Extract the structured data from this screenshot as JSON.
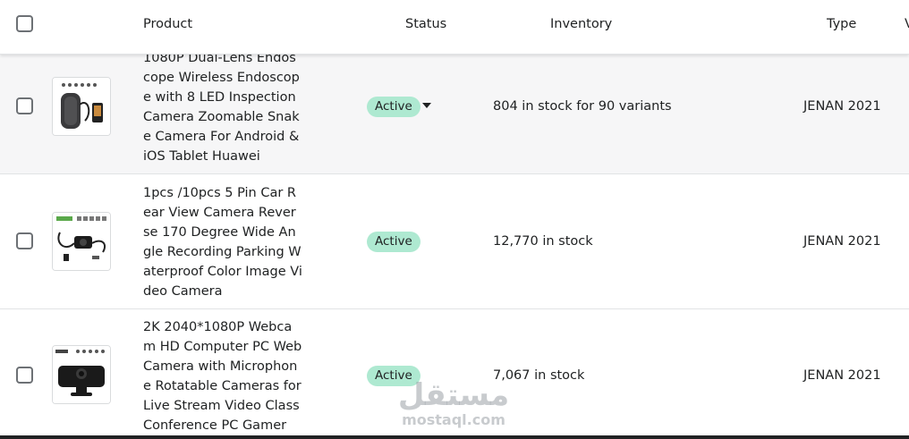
{
  "header": {
    "product_label": "Product",
    "status_label": "Status",
    "inventory_label": "Inventory",
    "type_label": "Type",
    "overflow_label": "V"
  },
  "rows": [
    {
      "name": "1080P Dual-Lens Endoscope Wireless Endoscope with 8 LED Inspection Camera Zoomable Snake Camera For Android & iOS Tablet Huawei",
      "status": "Active",
      "inventory": "804 in stock for 90 variants",
      "type": "JENAN 2021",
      "hovered": true
    },
    {
      "name": "1pcs /10pcs 5 Pin Car Rear View Camera Reverse 170 Degree Wide Angle Recording Parking Waterproof Color Image Video Camera",
      "status": "Active",
      "inventory": "12,770 in stock",
      "type": "JENAN 2021",
      "hovered": false
    },
    {
      "name": "2K 2040*1080P Webcam HD Computer PC WebCamera with Microphone Rotatable Cameras for Live Stream Video Class Conference PC Gamer",
      "status": "Active",
      "inventory": "7,067 in stock",
      "type": "JENAN 2021",
      "hovered": false
    }
  ],
  "watermark": {
    "arabic": "مستقل",
    "latin": "mostaql.com"
  },
  "colors": {
    "badge_success": "#aee9d1",
    "row_hover": "#f6f6f7",
    "border": "#e1e3e5",
    "text": "#202223"
  }
}
